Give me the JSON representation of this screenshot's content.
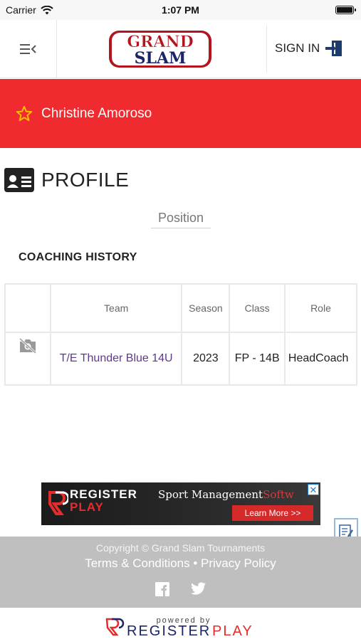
{
  "status_bar": {
    "carrier": "Carrier",
    "time": "1:07 PM"
  },
  "header": {
    "logo_line1": "GRAND",
    "logo_line2": "SLAM",
    "signin_label": "SIGN IN"
  },
  "banner": {
    "name": "Christine Amoroso"
  },
  "profile": {
    "title": "PROFILE",
    "position_label": "Position"
  },
  "coaching_history": {
    "title": "COACHING HISTORY",
    "columns": [
      "",
      "Team",
      "Season",
      "Class",
      "Role"
    ],
    "rows": [
      {
        "team": "T/E Thunder Blue 14U",
        "season": "2023",
        "class": "FP - 14B",
        "role": "HeadCoach"
      }
    ]
  },
  "ad": {
    "brand_line1": "REGISTER",
    "brand_line2": "PLAY",
    "tagline": "Sport Management",
    "tagline_faded": "Softw",
    "cta": "Learn More >>",
    "close": "✕"
  },
  "footer": {
    "copyright": "Copyright © Grand Slam Tournaments",
    "terms": "Terms & Conditions",
    "separator": "•",
    "privacy": "Privacy Policy"
  },
  "powered_by": {
    "small": "powered by",
    "brand_left": "REGISTER",
    "brand_right": "PLAY"
  },
  "colors": {
    "banner": "#ef2b2f",
    "link_purple": "#5c3a8c",
    "star": "#f5c000",
    "footer": "#bfbfbf"
  },
  "icons": [
    "wifi-icon",
    "battery-icon",
    "menu-collapse-icon",
    "sign-in-icon",
    "star-icon",
    "id-card-icon",
    "no-photo-icon",
    "feedback-icon",
    "facebook-icon",
    "twitter-icon"
  ]
}
